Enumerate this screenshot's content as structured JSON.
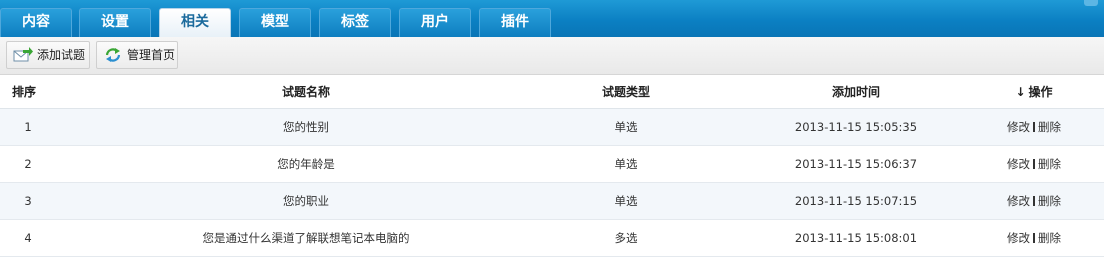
{
  "nav": {
    "tabs": [
      {
        "label": "内容"
      },
      {
        "label": "设置"
      },
      {
        "label": "相关",
        "active": true
      },
      {
        "label": "模型"
      },
      {
        "label": "标签"
      },
      {
        "label": "用户"
      },
      {
        "label": "插件"
      }
    ]
  },
  "toolbar": {
    "add_label": "添加试题",
    "home_label": "管理首页",
    "add_icon": "envelope-arrow-icon",
    "home_icon": "refresh-icon"
  },
  "table": {
    "columns": {
      "index": "排序",
      "name": "试题名称",
      "type": "试题类型",
      "time": "添加时间",
      "ops": "操作",
      "sort_icon": "arrow-down-icon"
    },
    "rows": [
      {
        "index": "1",
        "name": "您的性别",
        "type": "单选",
        "time": "2013-11-15 15:05:35",
        "edit": "修改",
        "delete": "删除"
      },
      {
        "index": "2",
        "name": "您的年龄是",
        "type": "单选",
        "time": "2013-11-15 15:06:37",
        "edit": "修改",
        "delete": "删除"
      },
      {
        "index": "3",
        "name": "您的职业",
        "type": "单选",
        "time": "2013-11-15 15:07:15",
        "edit": "修改",
        "delete": "删除"
      },
      {
        "index": "4",
        "name": "您是通过什么渠道了解联想笔记本电脑的",
        "type": "多选",
        "time": "2013-11-15 15:08:01",
        "edit": "修改",
        "delete": "删除"
      }
    ]
  },
  "colors": {
    "topbar": "#0b80c3",
    "active_tab_text": "#1b6a9c",
    "row_alt": "#f3f7fb"
  }
}
